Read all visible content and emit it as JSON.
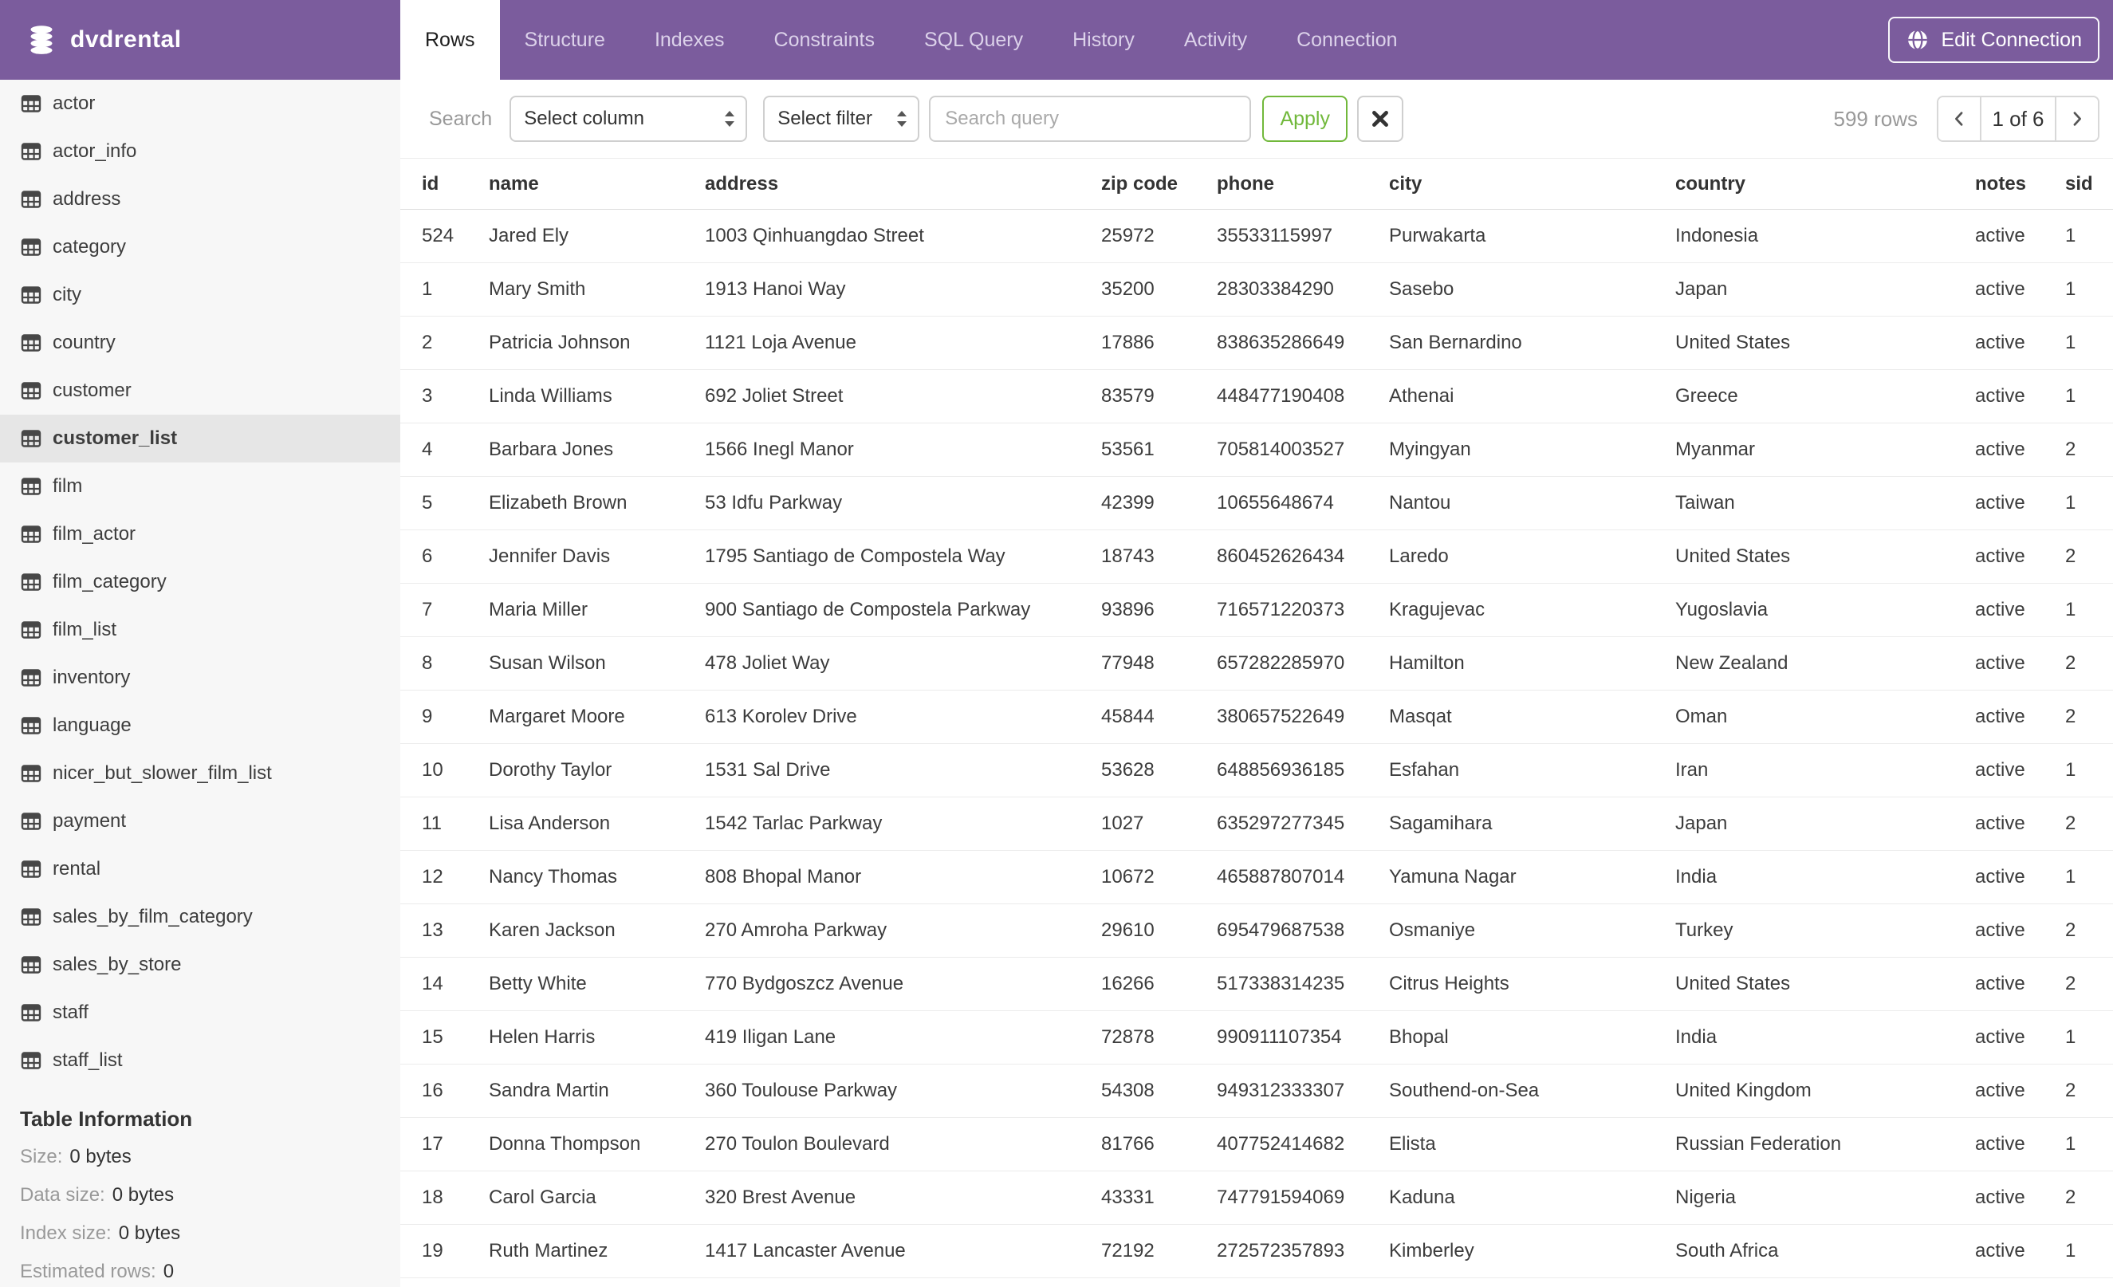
{
  "colors": {
    "header_purple": "#7B5C9D",
    "accent_green": "#71B83B",
    "sidebar_bg": "#F7F7F7",
    "sidebar_selected_bg": "#E6E6E6",
    "border_gray": "#CFCFCF",
    "row_border": "#ECECEC",
    "text_dark": "#3C3C3C",
    "text_muted": "#999999"
  },
  "header": {
    "app_title": "dvdrental",
    "logo_icon": "database-icon",
    "tabs": [
      {
        "label": "Rows",
        "active": true
      },
      {
        "label": "Structure",
        "active": false
      },
      {
        "label": "Indexes",
        "active": false
      },
      {
        "label": "Constraints",
        "active": false
      },
      {
        "label": "SQL Query",
        "active": false
      },
      {
        "label": "History",
        "active": false
      },
      {
        "label": "Activity",
        "active": false
      },
      {
        "label": "Connection",
        "active": false
      }
    ],
    "edit_connection": {
      "label": "Edit Connection",
      "icon": "globe-icon"
    }
  },
  "sidebar": {
    "item_icon": "table-grid-icon",
    "tables": [
      "actor",
      "actor_info",
      "address",
      "category",
      "city",
      "country",
      "customer",
      "customer_list",
      "film",
      "film_actor",
      "film_category",
      "film_list",
      "inventory",
      "language",
      "nicer_but_slower_film_list",
      "payment",
      "rental",
      "sales_by_film_category",
      "sales_by_store",
      "staff",
      "staff_list"
    ],
    "selected_table": "customer_list",
    "table_information": {
      "heading": "Table Information",
      "fields": [
        {
          "label": "Size:",
          "value": "0 bytes"
        },
        {
          "label": "Data size:",
          "value": "0 bytes"
        },
        {
          "label": "Index size:",
          "value": "0 bytes"
        },
        {
          "label": "Estimated rows:",
          "value": "0"
        }
      ]
    }
  },
  "toolbar": {
    "search_label": "Search",
    "column_select_value": "Select column",
    "column_select_icon": "up-down-arrows-icon",
    "filter_select_value": "Select filter",
    "filter_select_icon": "up-down-arrows-icon",
    "query_placeholder": "Search query",
    "apply_label": "Apply",
    "clear_icon": "x-icon",
    "rows_count": "599 rows",
    "pagination": {
      "prev_icon": "chevron-left-icon",
      "page_indicator": "1 of 6",
      "next_icon": "chevron-right-icon"
    }
  },
  "table": {
    "columns": [
      "id",
      "name",
      "address",
      "zip code",
      "phone",
      "city",
      "country",
      "notes",
      "sid"
    ],
    "rows": [
      [
        524,
        "Jared Ely",
        "1003 Qinhuangdao Street",
        "25972",
        "35533115997",
        "Purwakarta",
        "Indonesia",
        "active",
        1
      ],
      [
        1,
        "Mary Smith",
        "1913 Hanoi Way",
        "35200",
        "28303384290",
        "Sasebo",
        "Japan",
        "active",
        1
      ],
      [
        2,
        "Patricia Johnson",
        "1121 Loja Avenue",
        "17886",
        "838635286649",
        "San Bernardino",
        "United States",
        "active",
        1
      ],
      [
        3,
        "Linda Williams",
        "692 Joliet Street",
        "83579",
        "448477190408",
        "Athenai",
        "Greece",
        "active",
        1
      ],
      [
        4,
        "Barbara Jones",
        "1566 Inegl Manor",
        "53561",
        "705814003527",
        "Myingyan",
        "Myanmar",
        "active",
        2
      ],
      [
        5,
        "Elizabeth Brown",
        "53 Idfu Parkway",
        "42399",
        "10655648674",
        "Nantou",
        "Taiwan",
        "active",
        1
      ],
      [
        6,
        "Jennifer Davis",
        "1795 Santiago de Compostela Way",
        "18743",
        "860452626434",
        "Laredo",
        "United States",
        "active",
        2
      ],
      [
        7,
        "Maria Miller",
        "900 Santiago de Compostela Parkway",
        "93896",
        "716571220373",
        "Kragujevac",
        "Yugoslavia",
        "active",
        1
      ],
      [
        8,
        "Susan Wilson",
        "478 Joliet Way",
        "77948",
        "657282285970",
        "Hamilton",
        "New Zealand",
        "active",
        2
      ],
      [
        9,
        "Margaret Moore",
        "613 Korolev Drive",
        "45844",
        "380657522649",
        "Masqat",
        "Oman",
        "active",
        2
      ],
      [
        10,
        "Dorothy Taylor",
        "1531 Sal Drive",
        "53628",
        "648856936185",
        "Esfahan",
        "Iran",
        "active",
        1
      ],
      [
        11,
        "Lisa Anderson",
        "1542 Tarlac Parkway",
        "1027",
        "635297277345",
        "Sagamihara",
        "Japan",
        "active",
        2
      ],
      [
        12,
        "Nancy Thomas",
        "808 Bhopal Manor",
        "10672",
        "465887807014",
        "Yamuna Nagar",
        "India",
        "active",
        1
      ],
      [
        13,
        "Karen Jackson",
        "270 Amroha Parkway",
        "29610",
        "695479687538",
        "Osmaniye",
        "Turkey",
        "active",
        2
      ],
      [
        14,
        "Betty White",
        "770 Bydgoszcz Avenue",
        "16266",
        "517338314235",
        "Citrus Heights",
        "United States",
        "active",
        2
      ],
      [
        15,
        "Helen Harris",
        "419 Iligan Lane",
        "72878",
        "990911107354",
        "Bhopal",
        "India",
        "active",
        1
      ],
      [
        16,
        "Sandra Martin",
        "360 Toulouse Parkway",
        "54308",
        "949312333307",
        "Southend-on-Sea",
        "United Kingdom",
        "active",
        2
      ],
      [
        17,
        "Donna Thompson",
        "270 Toulon Boulevard",
        "81766",
        "407752414682",
        "Elista",
        "Russian Federation",
        "active",
        1
      ],
      [
        18,
        "Carol Garcia",
        "320 Brest Avenue",
        "43331",
        "747791594069",
        "Kaduna",
        "Nigeria",
        "active",
        2
      ],
      [
        19,
        "Ruth Martinez",
        "1417 Lancaster Avenue",
        "72192",
        "272572357893",
        "Kimberley",
        "South Africa",
        "active",
        1
      ]
    ]
  }
}
